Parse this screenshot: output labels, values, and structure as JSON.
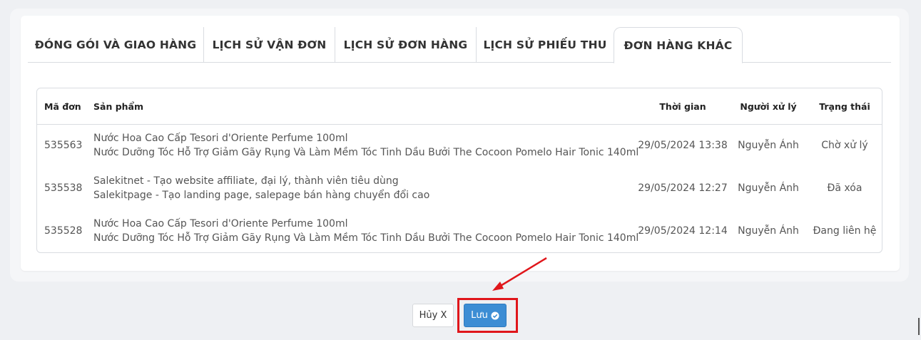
{
  "tabs": [
    {
      "label": "ĐÓNG GÓI VÀ GIAO HÀNG",
      "active": false
    },
    {
      "label": "LỊCH SỬ VẬN ĐƠN",
      "active": false
    },
    {
      "label": "LỊCH SỬ ĐƠN HÀNG",
      "active": false
    },
    {
      "label": "LỊCH SỬ PHIẾU THU",
      "active": false
    },
    {
      "label": "ĐƠN HÀNG KHÁC",
      "active": true
    }
  ],
  "table": {
    "columns": [
      "Mã đơn",
      "Sản phẩm",
      "Thời gian",
      "Người xử lý",
      "Trạng thái"
    ],
    "rows": [
      {
        "id": "535563",
        "products": [
          "Nước Hoa Cao Cấp Tesori d'Oriente Perfume 100ml",
          "Nước Dưỡng Tóc Hỗ Trợ Giảm Gãy Rụng Và Làm Mềm Tóc Tinh Dầu Bưởi The Cocoon Pomelo Hair Tonic 140ml"
        ],
        "time": "29/05/2024 13:38",
        "handler": "Nguyễn Ánh",
        "status": "Chờ xử lý"
      },
      {
        "id": "535538",
        "products": [
          "Salekitnet - Tạo website affiliate, đại lý, thành viên tiêu dùng",
          "Salekitpage - Tạo landing page, salepage bán hàng chuyển đổi cao"
        ],
        "time": "29/05/2024 12:27",
        "handler": "Nguyễn Ánh",
        "status": "Đã xóa"
      },
      {
        "id": "535528",
        "products": [
          "Nước Hoa Cao Cấp Tesori d'Oriente Perfume 100ml",
          "Nước Dưỡng Tóc Hỗ Trợ Giảm Gãy Rụng Và Làm Mềm Tóc Tinh Dầu Bưởi The Cocoon Pomelo Hair Tonic 140ml"
        ],
        "time": "29/05/2024 12:14",
        "handler": "Nguyễn Ánh",
        "status": "Đang liên hệ"
      }
    ]
  },
  "buttons": {
    "cancel_label": "Hủy X",
    "save_label": "Lưu",
    "save_icon": "check-circle-icon"
  },
  "colors": {
    "accent": "#3c8dd4",
    "highlight": "#e0161b"
  }
}
